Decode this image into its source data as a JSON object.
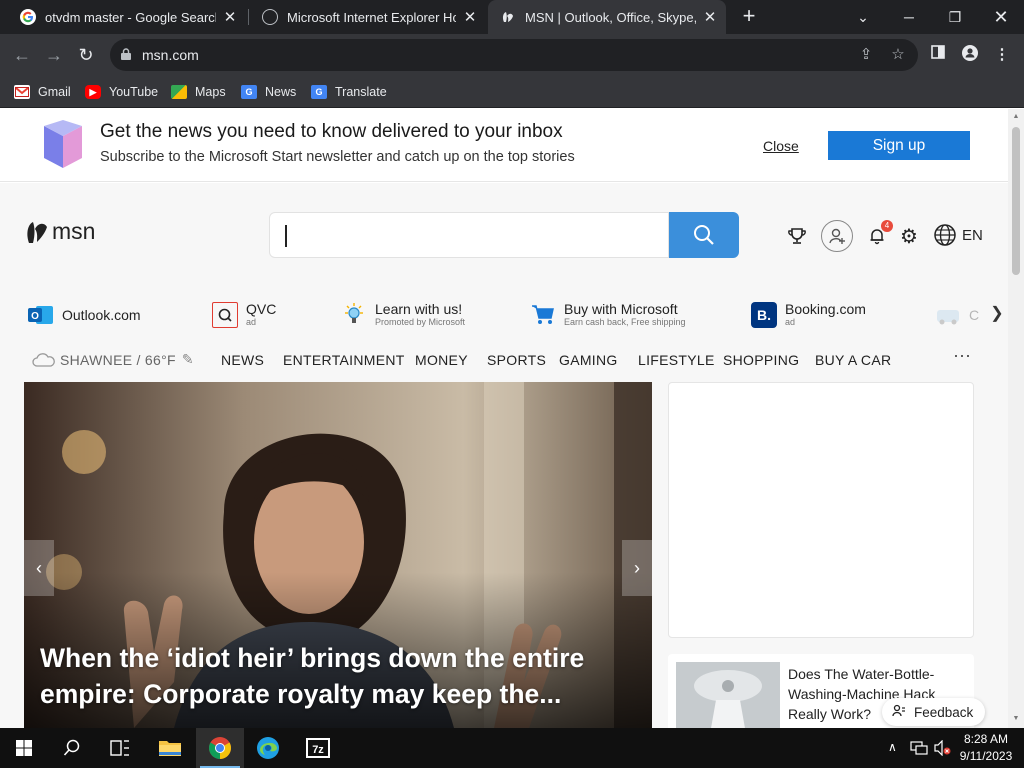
{
  "browser": {
    "tabs": [
      {
        "title": "otvdm master - Google Search",
        "favicon": "google-icon"
      },
      {
        "title": "Microsoft Internet Explorer Home",
        "favicon": "globe-icon"
      },
      {
        "title": "MSN | Outlook, Office, Skype, Bing",
        "favicon": "msn-icon",
        "active": true
      }
    ],
    "url": "msn.com",
    "bookmarks": [
      "Gmail",
      "YouTube",
      "Maps",
      "News",
      "Translate"
    ]
  },
  "banner": {
    "title": "Get the news you need to know delivered to your inbox",
    "subtitle": "Subscribe to the Microsoft Start newsletter and catch up on the top stories",
    "close_label": "Close",
    "signup_label": "Sign up"
  },
  "header": {
    "logo_text": "msn",
    "search_value": "",
    "notification_count": "4",
    "language": "EN"
  },
  "quicklinks": [
    {
      "label": "Outlook.com",
      "sub": ""
    },
    {
      "label": "QVC",
      "sub": "ad"
    },
    {
      "label": "Learn with us!",
      "sub": "Promoted by Microsoft"
    },
    {
      "label": "Buy with Microsoft",
      "sub": "Earn cash back, Free shipping"
    },
    {
      "label": "Booking.com",
      "sub": "ad"
    },
    {
      "label": "C",
      "sub": ""
    }
  ],
  "nav": {
    "weather": "SHAWNEE / 66°F",
    "items": [
      "NEWS",
      "ENTERTAINMENT",
      "MONEY",
      "SPORTS",
      "GAMING",
      "LIFESTYLE",
      "SHOPPING",
      "BUY A CAR"
    ],
    "more": "···"
  },
  "hero": {
    "headline": "When the ‘idiot heir’ brings down the entire empire: Corporate royalty may keep the..."
  },
  "side_story": {
    "title": "Does The Water-Bottle-Washing-Machine Hack Really Work?"
  },
  "feedback_label": "Feedback",
  "taskbar": {
    "time": "8:28 AM",
    "date": "9/11/2023"
  },
  "colors": {
    "chrome_dark": "#202124",
    "chrome_toolbar": "#35363a",
    "msn_blue": "#1a79d6",
    "search_blue": "#3b8fdb"
  }
}
